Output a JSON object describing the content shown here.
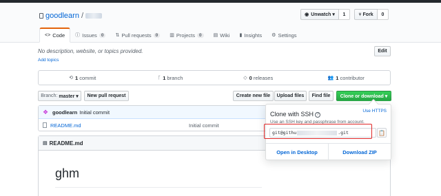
{
  "repo": {
    "owner": "goodlearn",
    "separator": "/"
  },
  "header": {
    "watch_label": "Unwatch ▾",
    "watch_count": "1",
    "fork_label": "Fork",
    "fork_count": "0"
  },
  "tabs": [
    {
      "label": "Code",
      "icon": "code-icon",
      "count": ""
    },
    {
      "label": "Issues",
      "icon": "issue-icon",
      "count": "0"
    },
    {
      "label": "Pull requests",
      "icon": "pull-request-icon",
      "count": "0"
    },
    {
      "label": "Projects",
      "icon": "project-icon",
      "count": "0"
    },
    {
      "label": "Wiki",
      "icon": "book-icon",
      "count": ""
    },
    {
      "label": "Insights",
      "icon": "graph-icon",
      "count": ""
    },
    {
      "label": "Settings",
      "icon": "gear-icon",
      "count": ""
    }
  ],
  "description": "No description, website, or topics provided.",
  "add_topics": "Add topics",
  "edit_label": "Edit",
  "stats": {
    "commits_count": "1",
    "commits_label": "commit",
    "branches_count": "1",
    "branches_label": "branch",
    "releases_count": "0",
    "releases_label": "releases",
    "contributors_count": "1",
    "contributors_label": "contributor"
  },
  "toolbar": {
    "branch_prefix": "Branch:",
    "branch_name": "master ▾",
    "new_pr": "New pull request",
    "create_file": "Create new file",
    "upload_files": "Upload files",
    "find_file": "Find file",
    "clone_download": "Clone or download ▾"
  },
  "commit": {
    "author": "goodlearn",
    "message": "Initial commit"
  },
  "files": [
    {
      "name": "README.md",
      "message": "Initial commit"
    }
  ],
  "readme": {
    "title": "README.md",
    "heading": "ghm"
  },
  "clone": {
    "title": "Clone with SSH",
    "help": "?",
    "use_https": "Use HTTPS",
    "desc": "Use an SSH key and passphrase from account.",
    "url_prefix": "git@githu",
    "url_suffix": ".git",
    "open_desktop": "Open in Desktop",
    "download_zip": "Download ZIP"
  },
  "colors": {
    "accent": "#0366d6",
    "green": "#28a745",
    "highlight": "#e02626",
    "tab_active": "#e36209"
  }
}
